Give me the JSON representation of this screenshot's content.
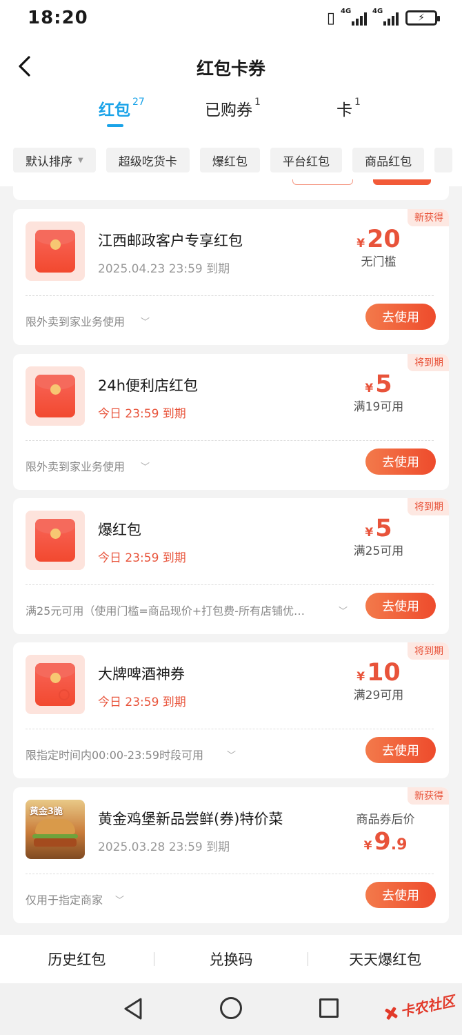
{
  "status_bar": {
    "time": "18:20",
    "sig1": "4G",
    "sig2": "4G"
  },
  "header": {
    "title": "红包卡券"
  },
  "tabs": [
    {
      "label": "红包",
      "count": "27",
      "active": true
    },
    {
      "label": "已购券",
      "count": "1",
      "active": false
    },
    {
      "label": "卡",
      "count": "1",
      "active": false
    }
  ],
  "filters": [
    "默认排序",
    "超级吃货卡",
    "爆红包",
    "平台红包",
    "商品红包"
  ],
  "coupons": [
    {
      "badge": "新获得",
      "name": "江西邮政客户专享红包",
      "expiry": "2025.04.23 23:59 到期",
      "currency": "¥",
      "amount": "20",
      "decimal": "",
      "pre": "",
      "condition": "无门槛",
      "rule": "限外卖到家业务使用",
      "button": "去使用"
    },
    {
      "badge": "将到期",
      "name": "24h便利店红包",
      "expiry": "今日 23:59 到期",
      "currency": "¥",
      "amount": "5",
      "decimal": "",
      "pre": "",
      "condition": "满19可用",
      "rule": "限外卖到家业务使用",
      "button": "去使用"
    },
    {
      "badge": "将到期",
      "name": "爆红包",
      "expiry": "今日 23:59 到期",
      "currency": "¥",
      "amount": "5",
      "decimal": "",
      "pre": "",
      "condition": "满25可用",
      "rule": "满25元可用（使用门槛=商品现价+打包费-所有店铺优…",
      "button": "去使用"
    },
    {
      "badge": "将到期",
      "name": "大牌啤酒神券",
      "expiry": "今日 23:59 到期",
      "currency": "¥",
      "amount": "10",
      "decimal": "",
      "pre": "",
      "condition": "满29可用",
      "rule": "限指定时间内00:00-23:59时段可用",
      "button": "去使用"
    },
    {
      "badge": "新获得",
      "name": "黄金鸡堡新品尝鲜(券)特价菜",
      "expiry": "2025.03.28 23:59 到期",
      "currency": "¥",
      "amount": "9",
      "decimal": ".9",
      "pre": "商品券后价",
      "condition": "",
      "rule": "仅用于指定商家",
      "button": "去使用",
      "thumb_text": "黄金3脆"
    }
  ],
  "bottom_bar": [
    "历史红包",
    "兑换码",
    "天天爆红包"
  ],
  "watermark": "卡农社区",
  "colors": {
    "accent": "#1aa3e8",
    "red": "#e8533a",
    "button": "#ee4b2c"
  }
}
